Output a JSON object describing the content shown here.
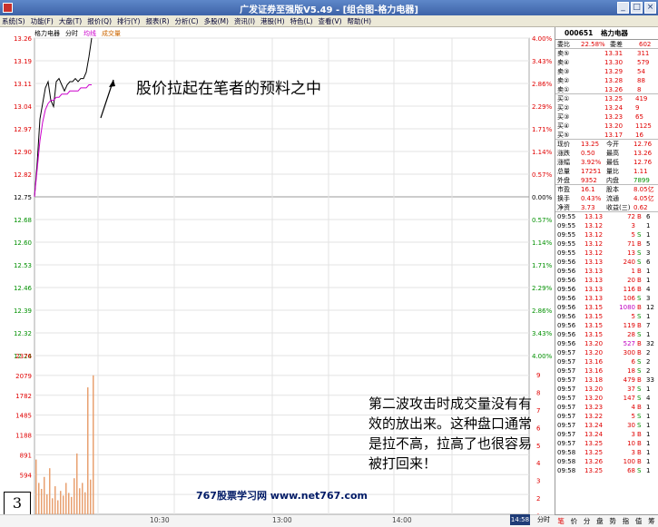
{
  "window": {
    "title": "广发证券至强版V5.49 - [组合图-格力电器]"
  },
  "menu": [
    "系统(S)",
    "功能(F)",
    "大盘(T)",
    "报价(Q)",
    "排行(Y)",
    "报表(R)",
    "分析(C)",
    "多股(M)",
    "资讯(I)",
    "港股(H)",
    "特色(L)",
    "查看(V)",
    "帮助(H)"
  ],
  "stock_header": {
    "label": "格力电器",
    "tab": "分时",
    "avg_label": "均线",
    "vol_label": "成交量"
  },
  "price_axis_left": [
    "13.26",
    "13.19",
    "13.11",
    "13.04",
    "12.97",
    "12.90",
    "12.82",
    "12.75",
    "12.68",
    "12.60",
    "12.53",
    "12.46",
    "12.39",
    "12.32",
    "12.24"
  ],
  "pct_axis_right": [
    "4.00%",
    "3.43%",
    "2.86%",
    "2.29%",
    "1.71%",
    "1.14%",
    "0.57%",
    "0.00%",
    "0.57%",
    "1.14%",
    "1.71%",
    "2.29%",
    "2.86%",
    "3.43%",
    "4.00%"
  ],
  "current_price_tag": "12.90",
  "volume_axis_left": [
    "2376",
    "2079",
    "1782",
    "1485",
    "1188",
    "891",
    "594",
    "297"
  ],
  "volume_axis_right": [
    "9",
    "8",
    "7",
    "6",
    "5",
    "4",
    "3",
    "2",
    "1"
  ],
  "time_axis": [
    "10:30",
    "13:00",
    "14:00"
  ],
  "annotation_1": "股价拉起在笔者的预料之中",
  "annotation_2": "第二波攻击时成交量没有有效的放出来。这种盘口通常是拉不高，拉高了也很容易被打回来！",
  "footer_watermark": "767股票学习网  www.net767.com",
  "figure_number": "3",
  "status": {
    "time_badge": "14:58",
    "tab": "分时"
  },
  "right_panel": {
    "code": "000651",
    "name": "格力电器",
    "ratio": {
      "label": "委比",
      "value": "22.58%",
      "diff_label": "委差",
      "diff": "602"
    },
    "asks": [
      {
        "label": "卖⑤",
        "price": "13.31",
        "vol": "311"
      },
      {
        "label": "卖④",
        "price": "13.30",
        "vol": "579"
      },
      {
        "label": "卖③",
        "price": "13.29",
        "vol": "54"
      },
      {
        "label": "卖②",
        "price": "13.28",
        "vol": "88"
      },
      {
        "label": "卖①",
        "price": "13.26",
        "vol": "8"
      }
    ],
    "bids": [
      {
        "label": "买①",
        "price": "13.25",
        "vol": "419"
      },
      {
        "label": "买②",
        "price": "13.24",
        "vol": "9"
      },
      {
        "label": "买③",
        "price": "13.23",
        "vol": "65"
      },
      {
        "label": "买④",
        "price": "13.20",
        "vol": "1125"
      },
      {
        "label": "买⑤",
        "price": "13.17",
        "vol": "16"
      }
    ],
    "stats": [
      {
        "l1": "现价",
        "v1": "13.25",
        "l2": "今开",
        "v2": "12.76"
      },
      {
        "l1": "涨跌",
        "v1": "0.50",
        "l2": "最高",
        "v2": "13.26"
      },
      {
        "l1": "涨幅",
        "v1": "3.92%",
        "l2": "最低",
        "v2": "12.76"
      },
      {
        "l1": "总量",
        "v1": "17251",
        "l2": "量比",
        "v2": "1.11"
      },
      {
        "l1": "外盘",
        "v1": "9352",
        "l2": "内盘",
        "v2": "7899"
      },
      {
        "l1": "市盈",
        "v1": "16.1",
        "l2": "股本",
        "v2": "8.05亿"
      },
      {
        "l1": "换手",
        "v1": "0.43%",
        "l2": "流通",
        "v2": "4.05亿"
      },
      {
        "l1": "净资",
        "v1": "3.73",
        "l2": "收益(三)",
        "v2": "0.62"
      }
    ],
    "ticks": [
      {
        "t": "09:55",
        "p": "13.13",
        "v": "72",
        "d": "B",
        "n": "6"
      },
      {
        "t": "09:55",
        "p": "13.12",
        "v": "3",
        "d": "",
        "n": "1"
      },
      {
        "t": "09:55",
        "p": "13.12",
        "v": "5",
        "d": "S",
        "n": "1"
      },
      {
        "t": "09:55",
        "p": "13.12",
        "v": "71",
        "d": "B",
        "n": "5"
      },
      {
        "t": "09:55",
        "p": "13.12",
        "v": "13",
        "d": "S",
        "n": "3"
      },
      {
        "t": "09:56",
        "p": "13.13",
        "v": "240",
        "d": "S",
        "n": "6"
      },
      {
        "t": "09:56",
        "p": "13.13",
        "v": "1",
        "d": "B",
        "n": "1"
      },
      {
        "t": "09:56",
        "p": "13.13",
        "v": "20",
        "d": "B",
        "n": "1"
      },
      {
        "t": "09:56",
        "p": "13.13",
        "v": "116",
        "d": "B",
        "n": "4"
      },
      {
        "t": "09:56",
        "p": "13.13",
        "v": "106",
        "d": "S",
        "n": "3"
      },
      {
        "t": "09:56",
        "p": "13.15",
        "v": "1080",
        "d": "B",
        "n": "12"
      },
      {
        "t": "09:56",
        "p": "13.15",
        "v": "5",
        "d": "S",
        "n": "1"
      },
      {
        "t": "09:56",
        "p": "13.15",
        "v": "119",
        "d": "B",
        "n": "7"
      },
      {
        "t": "09:56",
        "p": "13.15",
        "v": "28",
        "d": "S",
        "n": "1"
      },
      {
        "t": "09:56",
        "p": "13.20",
        "v": "527",
        "d": "B",
        "n": "32"
      },
      {
        "t": "09:57",
        "p": "13.20",
        "v": "300",
        "d": "B",
        "n": "2"
      },
      {
        "t": "09:57",
        "p": "13.16",
        "v": "6",
        "d": "S",
        "n": "2"
      },
      {
        "t": "09:57",
        "p": "13.16",
        "v": "18",
        "d": "S",
        "n": "2"
      },
      {
        "t": "09:57",
        "p": "13.18",
        "v": "479",
        "d": "B",
        "n": "33"
      },
      {
        "t": "09:57",
        "p": "13.20",
        "v": "37",
        "d": "S",
        "n": "1"
      },
      {
        "t": "09:57",
        "p": "13.20",
        "v": "147",
        "d": "S",
        "n": "4"
      },
      {
        "t": "09:57",
        "p": "13.23",
        "v": "4",
        "d": "B",
        "n": "1"
      },
      {
        "t": "09:57",
        "p": "13.22",
        "v": "5",
        "d": "S",
        "n": "1"
      },
      {
        "t": "09:57",
        "p": "13.24",
        "v": "30",
        "d": "S",
        "n": "1"
      },
      {
        "t": "09:57",
        "p": "13.24",
        "v": "3",
        "d": "B",
        "n": "1"
      },
      {
        "t": "09:57",
        "p": "13.25",
        "v": "10",
        "d": "B",
        "n": "1"
      },
      {
        "t": "09:58",
        "p": "13.25",
        "v": "3",
        "d": "B",
        "n": "1"
      },
      {
        "t": "09:58",
        "p": "13.26",
        "v": "100",
        "d": "B",
        "n": "1"
      },
      {
        "t": "09:58",
        "p": "13.25",
        "v": "68",
        "d": "S",
        "n": "1"
      }
    ],
    "tabs": [
      "笔",
      "价",
      "分",
      "盘",
      "势",
      "指",
      "值",
      "筹"
    ]
  }
}
